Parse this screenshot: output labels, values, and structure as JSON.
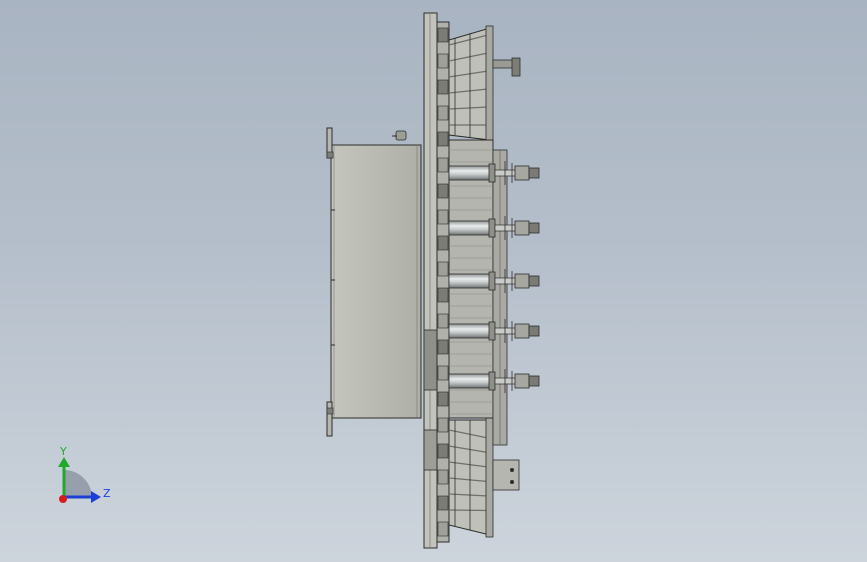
{
  "viewport": {
    "description_free": true,
    "colors": {
      "background_top": "#a9b4c2",
      "background_bottom": "#cdd4dc",
      "steel": "#b9bab3",
      "steel_dark": "#6d6f69",
      "edge": "#2c2d2b",
      "cylinder": "#d8dcdc",
      "rib": "#8a8c86"
    }
  },
  "triad": {
    "y_label": "Y",
    "z_label": "Z",
    "colors": {
      "y": "#1faa2a",
      "z": "#1c3fd6",
      "x": "#d41e1e",
      "arc": "#8d97a3"
    }
  }
}
